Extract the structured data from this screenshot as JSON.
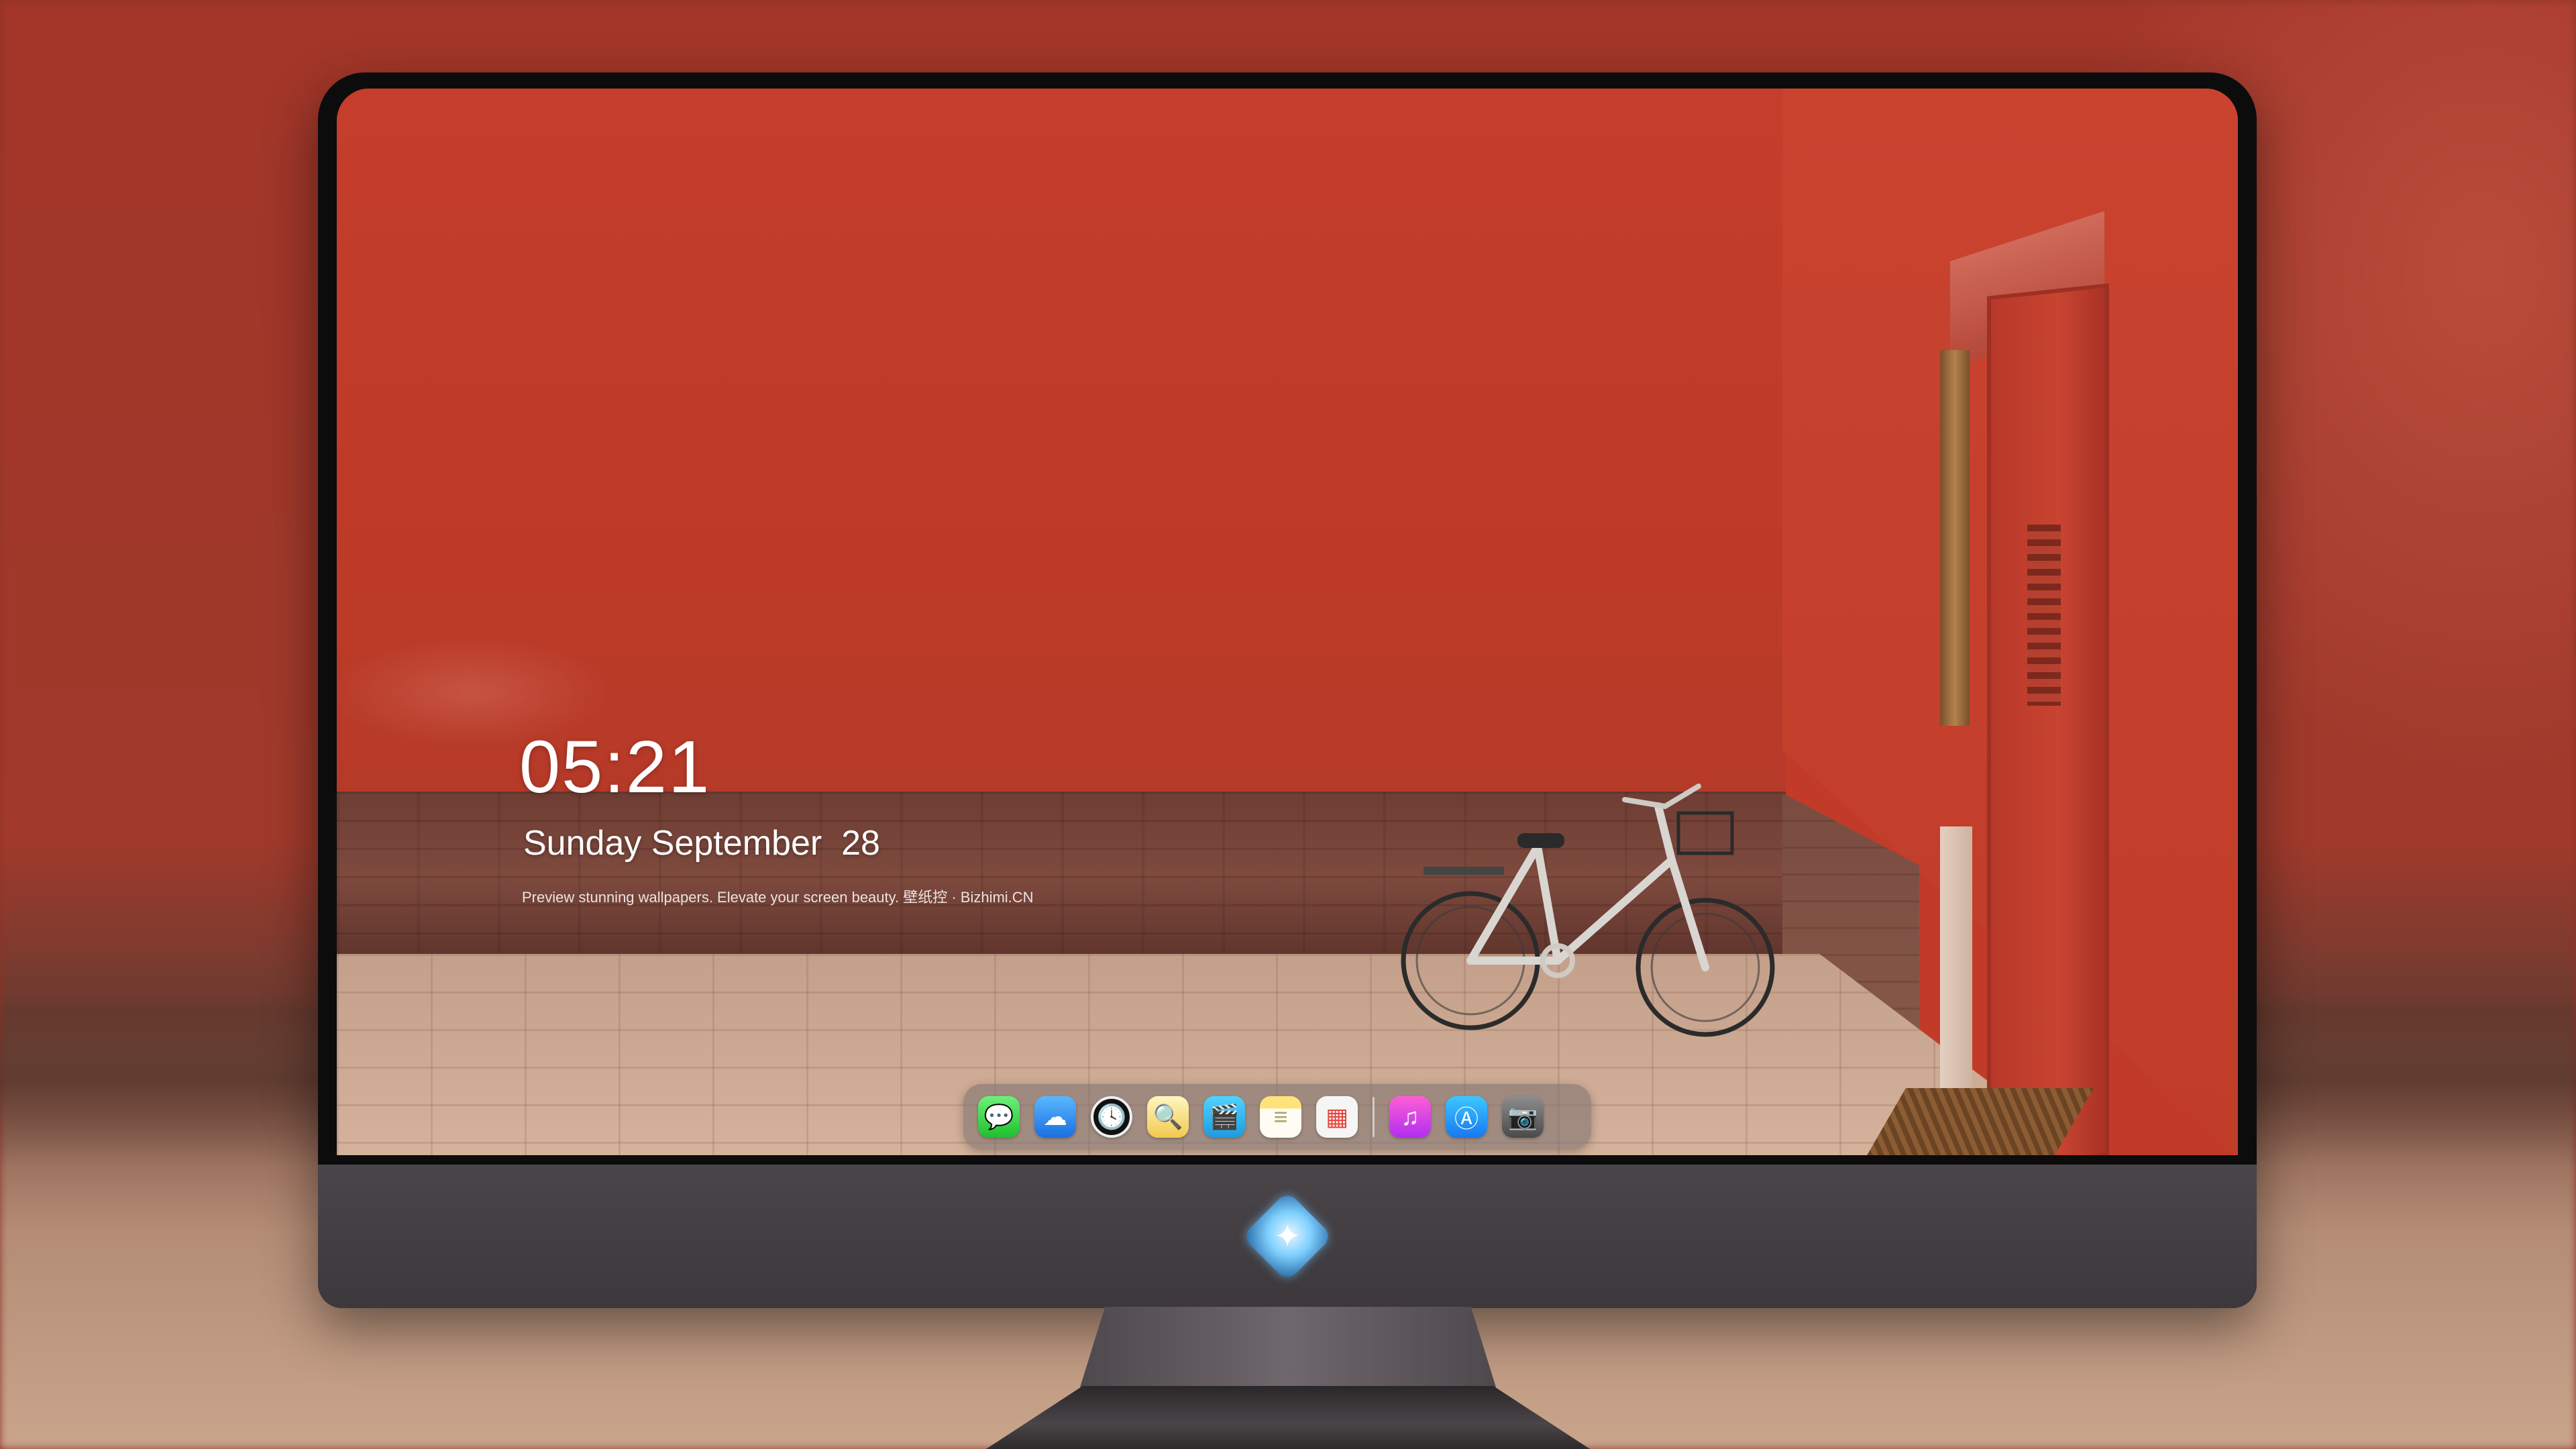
{
  "lock_screen": {
    "time": "05:21",
    "date": "Sunday September  28",
    "caption": "Preview stunning wallpapers. Elevate your screen beauty. 壁纸控 · Bizhimi.CN"
  },
  "dock": {
    "items": [
      {
        "name": "messages",
        "icon": "messages-icon",
        "glyph": "💬"
      },
      {
        "name": "weather",
        "icon": "weather-icon",
        "glyph": "☁"
      },
      {
        "name": "clock",
        "icon": "clock-icon",
        "glyph": "🕓"
      },
      {
        "name": "preview",
        "icon": "preview-icon",
        "glyph": "🔍"
      },
      {
        "name": "clips",
        "icon": "clips-icon",
        "glyph": "🎬"
      },
      {
        "name": "notes",
        "icon": "notes-icon",
        "glyph": "≡"
      },
      {
        "name": "photos",
        "icon": "photos-icon",
        "glyph": "▦"
      },
      {
        "name": "music",
        "icon": "music-icon",
        "glyph": "♫"
      },
      {
        "name": "app-store",
        "icon": "app-store-icon",
        "glyph": "Ⓐ"
      },
      {
        "name": "camera",
        "icon": "camera-icon",
        "glyph": "📷"
      }
    ]
  },
  "monitor": {
    "logo_icon": "mascot-logo-icon",
    "logo_glyph": "✦"
  },
  "colors": {
    "wall_red": "#c23b29",
    "bezel": "#0d0c0d",
    "chin": "#423e42"
  }
}
